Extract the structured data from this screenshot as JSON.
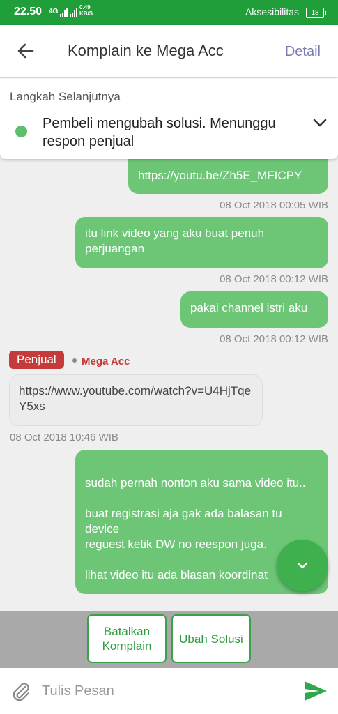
{
  "status_bar": {
    "time": "22.50",
    "network": "4G",
    "speed_value": "0.49",
    "speed_unit": "KB/S",
    "accessibility_label": "Aksesibilitas",
    "battery": "18"
  },
  "app_bar": {
    "title": "Komplain ke Mega Acc",
    "detail_label": "Detail"
  },
  "next_step": {
    "heading": "Langkah Selanjutnya",
    "text": "Pembeli mengubah solusi. Menunggu respon penjual",
    "status_color": "#5fbd6e"
  },
  "messages": [
    {
      "text": "https://youtu.be/Zh5E_MFICPY",
      "timestamp": "08 Oct 2018 00:05 WIB"
    },
    {
      "text": "itu link video yang aku buat penuh perjuangan",
      "timestamp": "08 Oct 2018 00:12 WIB"
    },
    {
      "text": "pakai channel istri aku",
      "timestamp": "08 Oct 2018 00:12 WIB"
    },
    {
      "badge": "Penjual",
      "sender": "Mega Acc",
      "text": "https://www.youtube.com/watch?v=U4HjTqeY5xs",
      "timestamp": "08 Oct 2018 10:46 WIB"
    },
    {
      "text": "sudah pernah nonton aku sama video itu..\n\nbuat registrasi aja gak ada balasan tu device\nreguest ketik DW no reespon juga.\n\nlihat video itu ada blasan koordinat"
    }
  ],
  "actions": {
    "cancel_label": "Batalkan Komplain",
    "change_label": "Ubah Solusi"
  },
  "composer": {
    "placeholder": "Tulis Pesan"
  },
  "colors": {
    "primary_green": "#1f9e3a",
    "bubble_green": "#6cc675",
    "seller_red": "#c53b3b",
    "detail_purple": "#7a7ab0"
  }
}
